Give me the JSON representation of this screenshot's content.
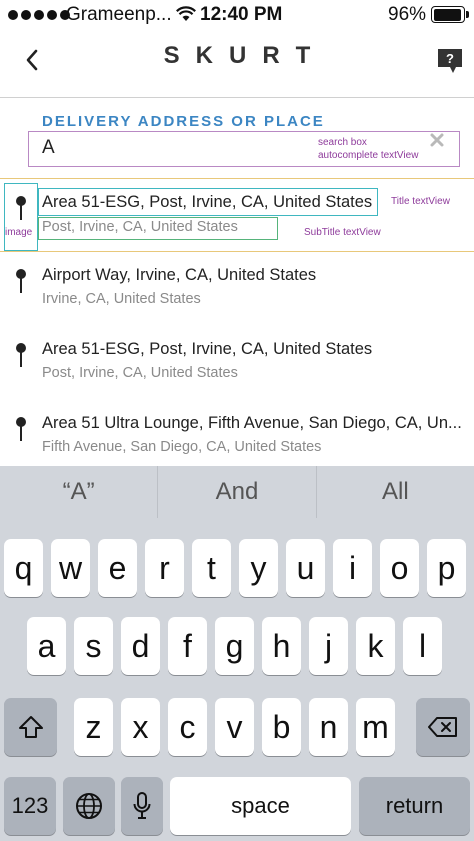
{
  "status_bar": {
    "carrier": "Grameenp...",
    "time": "12:40 PM",
    "battery": "96%",
    "battery_level": 0.96
  },
  "nav": {
    "title": "SKURT"
  },
  "search": {
    "section_label": "DELIVERY ADDRESS OR PLACE",
    "value": "A",
    "annotation_line1": "search box",
    "annotation_line2": "autocomplete textView"
  },
  "annotations": {
    "image": "image",
    "title": "Title textView",
    "subtitle": "SubTitle textView"
  },
  "results": [
    {
      "title": "Area 51-ESG, Post, Irvine, CA, United States",
      "subtitle": "Post, Irvine, CA, United States"
    },
    {
      "title": "Airport Way, Irvine, CA, United States",
      "subtitle": "Irvine, CA, United States"
    },
    {
      "title": "Area 51-ESG, Post, Irvine, CA, United States",
      "subtitle": "Post, Irvine, CA, United States"
    },
    {
      "title": "Area 51 Ultra Lounge, Fifth Avenue, San Diego, CA, Un...",
      "subtitle": "Fifth Avenue, San Diego, CA, United States"
    }
  ],
  "keyboard": {
    "suggestions": [
      "“A”",
      "And",
      "All"
    ],
    "row1": [
      "q",
      "w",
      "e",
      "r",
      "t",
      "y",
      "u",
      "i",
      "o",
      "p"
    ],
    "row2": [
      "a",
      "s",
      "d",
      "f",
      "g",
      "h",
      "j",
      "k",
      "l"
    ],
    "row3": [
      "z",
      "x",
      "c",
      "v",
      "b",
      "n",
      "m"
    ],
    "numbers_key": "123",
    "space_key": "space",
    "return_key": "return",
    "icons": [
      "shift-icon",
      "delete-icon",
      "globe-icon",
      "microphone-icon"
    ]
  }
}
